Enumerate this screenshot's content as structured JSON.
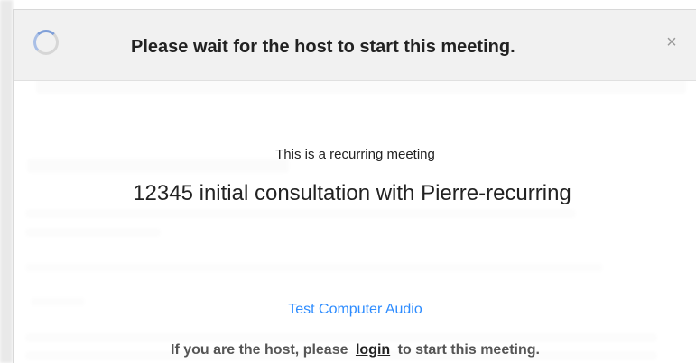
{
  "dialog": {
    "title": "Please wait for the host to start this meeting.",
    "close_symbol": "×",
    "recurring_note": "This is a recurring meeting",
    "meeting_topic": "12345 initial consultation with Pierre-recurring",
    "test_audio_label": "Test Computer Audio",
    "host_note_prefix": "If you are the host, please",
    "login_label": "login",
    "host_note_suffix": "to start this meeting."
  },
  "icons": {
    "spinner": "loading-spinner-icon",
    "close": "close-icon"
  },
  "colors": {
    "link": "#2d8cff",
    "header_bg": "#f1f1f1",
    "text": "#222222"
  }
}
